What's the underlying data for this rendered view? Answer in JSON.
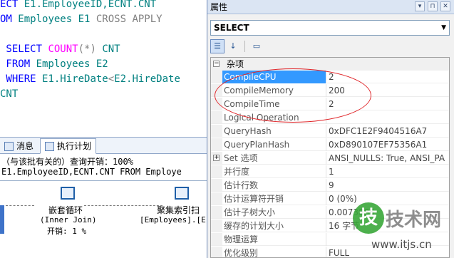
{
  "editor": {
    "lines": [
      {
        "parts": [
          {
            "t": "ECT ",
            "c": "kw"
          },
          {
            "t": "E1.EmployeeID,ECNT.CNT",
            "c": "tl"
          }
        ]
      },
      {
        "parts": [
          {
            "t": "OM ",
            "c": "kw"
          },
          {
            "t": "Employees E1 ",
            "c": "tl"
          },
          {
            "t": "CROSS APPLY",
            "c": "gr"
          }
        ]
      },
      {
        "parts": [
          {
            "t": "",
            "c": "tx"
          }
        ]
      },
      {
        "parts": [
          {
            "t": " SELECT ",
            "c": "kw"
          },
          {
            "t": "COUNT",
            "c": "fn"
          },
          {
            "t": "(*) ",
            "c": "gr"
          },
          {
            "t": "CNT",
            "c": "tl"
          }
        ]
      },
      {
        "parts": [
          {
            "t": " FROM ",
            "c": "kw"
          },
          {
            "t": "Employees E2",
            "c": "tl"
          }
        ]
      },
      {
        "parts": [
          {
            "t": " WHERE ",
            "c": "kw"
          },
          {
            "t": "E1.HireDate",
            "c": "tl"
          },
          {
            "t": "<",
            "c": "gr"
          },
          {
            "t": "E2.HireDate",
            "c": "tl"
          }
        ]
      },
      {
        "parts": [
          {
            "t": "CNT",
            "c": "tl"
          }
        ]
      }
    ]
  },
  "result_tabs": [
    {
      "label": "消息",
      "active": false
    },
    {
      "label": "执行计划",
      "active": true
    }
  ],
  "plan": {
    "header": "（与该批有关的）查询开销：100%",
    "query": "E1.EmployeeID,ECNT.CNT FROM Employe",
    "nested_loops": {
      "label": "嵌套循环",
      "sub": "(Inner Join)",
      "cost": "开销: 1 %"
    },
    "clustered_scan": {
      "label": "聚集索引扫",
      "sub": "[Employees].[E"
    }
  },
  "props": {
    "title": "属性",
    "object": "SELECT",
    "category": "杂项",
    "rows": [
      {
        "name": "CompileCPU",
        "value": "2",
        "selected": true
      },
      {
        "name": "CompileMemory",
        "value": "200"
      },
      {
        "name": "CompileTime",
        "value": "2"
      },
      {
        "name": "Logical Operation",
        "value": ""
      },
      {
        "name": "QueryHash",
        "value": "0xDFC1E2F9404516A7"
      },
      {
        "name": "QueryPlanHash",
        "value": "0xD890107EF75356A1"
      },
      {
        "name": "Set 选项",
        "value": "ANSI_NULLS: True, ANSI_PA",
        "expander": true
      },
      {
        "name": "并行度",
        "value": "1"
      },
      {
        "name": "估计行数",
        "value": "9"
      },
      {
        "name": "估计运算符开销",
        "value": "0 (0%)"
      },
      {
        "name": "估计子树大小",
        "value": "0.0073886"
      },
      {
        "name": "缓存的计划大小",
        "value": "16 字节"
      },
      {
        "name": "物理运算",
        "value": ""
      },
      {
        "name": "优化级别",
        "value": "FULL"
      }
    ]
  },
  "watermark": {
    "logo": "技",
    "title": "技术网",
    "url": "www.itjs.cn"
  }
}
